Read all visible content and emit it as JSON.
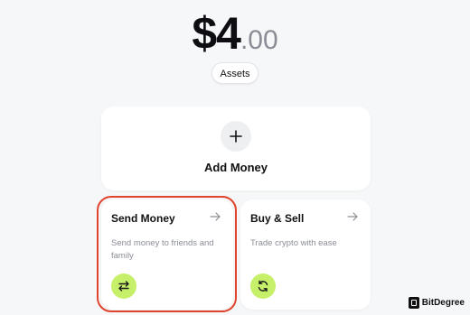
{
  "balance": {
    "whole": "$4",
    "cents": ".00"
  },
  "assets_button": {
    "label": "Assets"
  },
  "add_money": {
    "label": "Add Money",
    "icon": "plus-icon"
  },
  "cards": {
    "send": {
      "title": "Send Money",
      "description": "Send money to friends and family",
      "icon": "transfer-arrows-icon",
      "highlight_color": "#e0442f"
    },
    "buy_sell": {
      "title": "Buy & Sell",
      "description": "Trade crypto with ease",
      "icon": "refresh-icon"
    }
  },
  "colors": {
    "accent": "#c6f06a",
    "background": "#f6f7f8"
  },
  "watermark": {
    "text": "BitDegree"
  }
}
